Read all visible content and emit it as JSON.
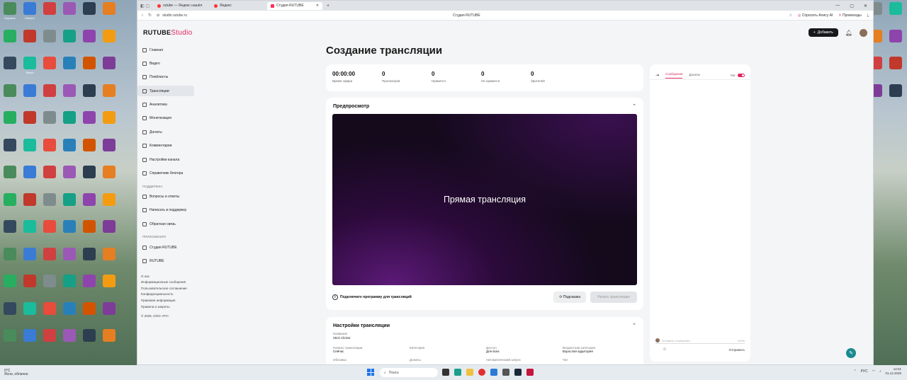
{
  "desktop": {
    "left_icons": [
      "Корзина",
      "Discord",
      "",
      "",
      "",
      "",
      "",
      "",
      "",
      "",
      "",
      "",
      "",
      "Steam",
      "",
      "",
      "",
      "",
      "",
      "",
      "",
      "",
      "",
      "",
      "",
      "",
      "",
      "",
      "",
      "",
      "",
      "",
      "",
      "",
      "",
      "",
      "",
      "",
      "",
      "",
      "",
      "",
      "",
      "",
      "",
      "",
      "",
      "",
      "",
      "",
      "",
      "",
      "",
      "",
      "",
      "",
      "",
      "",
      "",
      "",
      "",
      "",
      "",
      "",
      "",
      ""
    ],
    "colors": [
      "#4a8b5c",
      "#3a7bd5",
      "#d04040",
      "#9b59b6",
      "#2c3e50",
      "#e67e22",
      "#27ae60",
      "#c0392b",
      "#7f8c8d",
      "#16a085",
      "#8e44ad",
      "#f39c12",
      "#34495e",
      "#1abc9c",
      "#e74c3c",
      "#2980b9",
      "#d35400",
      "#7d3c98"
    ]
  },
  "browser": {
    "tabs": [
      {
        "label": "rutube — Яндекс нашёл",
        "icon": "yandex-icon"
      },
      {
        "label": "Яндекс",
        "icon": "yandex-icon"
      },
      {
        "label": "Студия RUTUBE",
        "icon": "rutube-icon",
        "active": true
      }
    ],
    "address": "studio.rutube.ru",
    "page_title": "Студия RUTUBE",
    "alice_label": "Спросить Алису AI",
    "promo_label": "Промокоды"
  },
  "header": {
    "logo_main": "RUTUBE",
    "logo_studio": "Studio",
    "add_label": "Добавить"
  },
  "sidebar": {
    "items": [
      {
        "label": "Главная",
        "icon": "home-icon"
      },
      {
        "label": "Видео",
        "icon": "video-icon"
      },
      {
        "label": "Плейлисты",
        "icon": "playlist-icon"
      },
      {
        "label": "Трансляции",
        "icon": "broadcast-icon",
        "active": true
      },
      {
        "label": "Аналитика",
        "icon": "analytics-icon"
      },
      {
        "label": "Монетизация",
        "icon": "money-icon"
      },
      {
        "label": "Донаты",
        "icon": "donate-icon"
      },
      {
        "label": "Комментарии",
        "icon": "comments-icon"
      },
      {
        "label": "Настройки канала",
        "icon": "settings-icon"
      },
      {
        "label": "Справочник блогера",
        "icon": "guide-icon"
      }
    ],
    "support_heading": "ПОДДЕРЖКА",
    "support_items": [
      {
        "label": "Вопросы и ответы",
        "icon": "question-icon"
      },
      {
        "label": "Написать в поддержку",
        "icon": "mail-icon"
      },
      {
        "label": "Обратная связь",
        "icon": "feedback-icon"
      }
    ],
    "apps_heading": "ПРИЛОЖЕНИЯ",
    "apps_items": [
      {
        "label": "Студия RUTUBE",
        "icon": "studio-app-icon"
      },
      {
        "label": "RUTUBE",
        "icon": "rutube-app-icon"
      }
    ],
    "footer_links": [
      "О нас",
      "Информационные сообщения",
      "Пользовательское соглашение",
      "Конфиденциальность",
      "Правовая информация",
      "Правила и запреты"
    ],
    "copyright": "© 2025, ООО «РУ»"
  },
  "main": {
    "title": "Создание трансляции",
    "stats": [
      {
        "value": "00:00:00",
        "label": "Время эфира"
      },
      {
        "value": "0",
        "label": "Просмотров"
      },
      {
        "value": "0",
        "label": "Нравится"
      },
      {
        "value": "0",
        "label": "Не нравится"
      },
      {
        "value": "0",
        "label": "Зрителей"
      }
    ],
    "preview_title": "Предпросмотр",
    "video_text": "Прямая трансляция",
    "connect_hint": "Подключите программу для трансляций",
    "help_button": "Подсказка",
    "start_button": "Начать трансляцию",
    "settings_title": "Настройки трансляции",
    "settings_name_label": "Название",
    "settings_name_value": "Stick Clicker",
    "settings_cols": [
      {
        "k": "Начало трансляции",
        "v": "Сейчас"
      },
      {
        "k": "Категория",
        "v": ""
      },
      {
        "k": "Доступ",
        "v": "Для всех"
      },
      {
        "k": "Возрастная категория",
        "v": "Взрослая аудитория"
      }
    ],
    "settings_cols2": [
      {
        "k": "Обложка",
        "v": ""
      },
      {
        "k": "Донаты",
        "v": ""
      },
      {
        "k": "Автоматический запуск",
        "v": ""
      },
      {
        "k": "Чат",
        "v": ""
      }
    ]
  },
  "chat": {
    "tab_messages": "Сообщения",
    "tab_donates": "Донаты",
    "toggle_label": "Чат",
    "input_placeholder": "Оставить сообщение...",
    "counter": "0/200",
    "send_label": "Отправить"
  },
  "taskbar": {
    "weather_temp": "0°C",
    "weather_text": "Ясно, облачно",
    "search_placeholder": "Поиск",
    "time": "12:01",
    "date": "01.12.2025",
    "lang": "РУС"
  }
}
